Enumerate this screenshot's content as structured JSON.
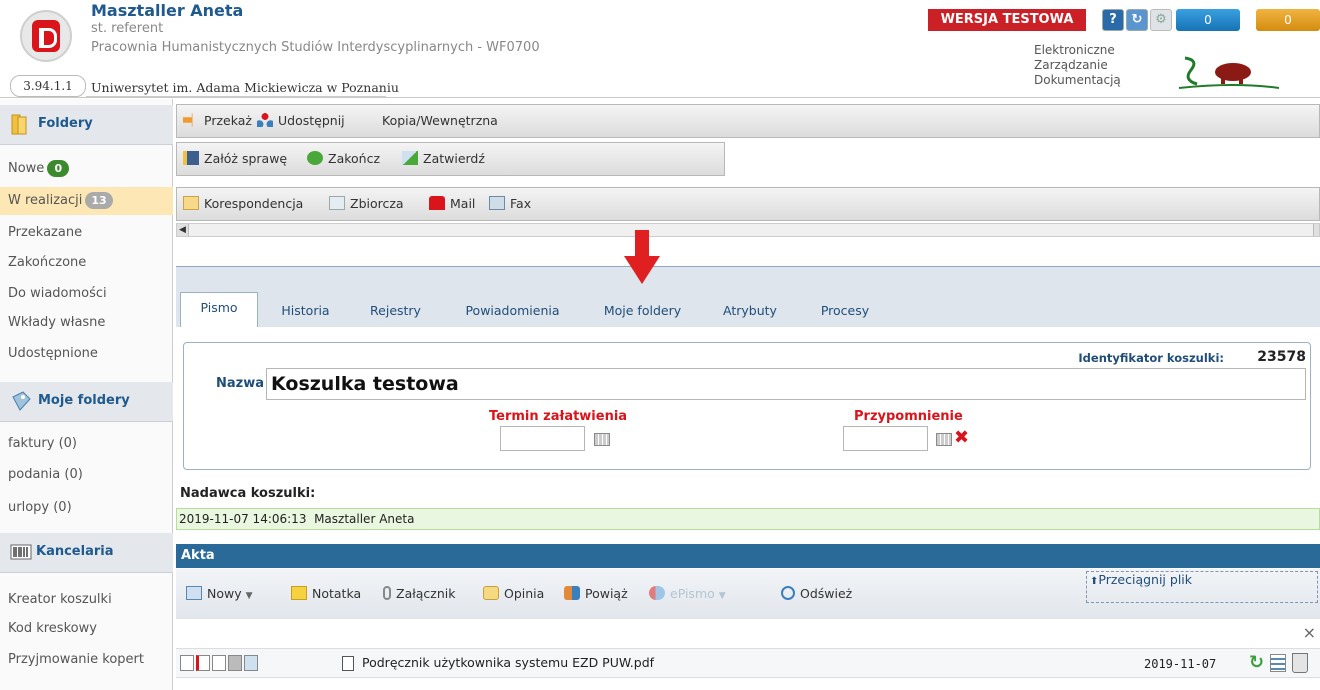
{
  "header": {
    "user_name": "Masztaller Aneta",
    "role": "st. referent",
    "department": "Pracownia Humanistycznych Studiów Interdyscyplinarnych - WF0700",
    "university": "Uniwersytet im. Adama Mickiewicza w Poznaniu",
    "version": "3.94.1.1",
    "test_banner": "WERSJA TESTOWA",
    "help_icon": "?",
    "counter1": "0",
    "counter2": "0",
    "ezd_line1": "Elektroniczne",
    "ezd_line2": "Zarządzanie",
    "ezd_line3": "Dokumentacją"
  },
  "sidebar": {
    "folders_header": "Foldery",
    "folders": [
      {
        "label": "Nowe",
        "badge": "0"
      },
      {
        "label": "W realizacji",
        "badge": "13"
      },
      {
        "label": "Przekazane"
      },
      {
        "label": "Zakończone"
      },
      {
        "label": "Do wiadomości"
      },
      {
        "label": "Wkłady własne"
      },
      {
        "label": "Udostępnione"
      }
    ],
    "my_folders_header": "Moje foldery",
    "my_folders": [
      "faktury (0)",
      "podania (0)",
      "urlopy (0)"
    ],
    "office_header": "Kancelaria",
    "office": [
      "Kreator koszulki",
      "Kod kreskowy",
      "Przyjmowanie kopert"
    ]
  },
  "toolbar1": {
    "forward": "Przekaż",
    "share": "Udostępnij",
    "copy": "Kopia/Wewnętrzna"
  },
  "toolbar2": {
    "create_case": "Załóż sprawę",
    "finish": "Zakończ",
    "approve": "Zatwierdź"
  },
  "toolbar3": {
    "correspondence": "Korespondencja",
    "collective": "Zbiorcza",
    "mail": "Mail",
    "fax": "Fax"
  },
  "tabs": [
    "Pismo",
    "Historia",
    "Rejestry",
    "Powiadomienia",
    "Moje foldery",
    "Atrybuty",
    "Procesy"
  ],
  "form": {
    "id_label": "Identyfikator koszulki:",
    "id_value": "23578",
    "name_label": "Nazwa",
    "name_value": "Koszulka testowa",
    "deadline_label": "Termin załatwienia",
    "reminder_label": "Przypomnienie"
  },
  "sender": {
    "label": "Nadawca koszulki:",
    "value": "2019-11-07 14:06:13  Masztaller Aneta"
  },
  "akta": {
    "title": "Akta",
    "new": "Nowy",
    "note": "Notatka",
    "attachment": "Załącznik",
    "opinion": "Opinia",
    "link": "Powiąż",
    "epismo": "ePismo",
    "refresh": "Odśwież",
    "drag": "Przeciągnij plik"
  },
  "file": {
    "name": "Podręcznik użytkownika systemu EZD PUW.pdf",
    "date": "2019-11-07",
    "close_x": "×"
  },
  "colors": {
    "accent_blue": "#2a6a99",
    "red": "#d9141b",
    "green_badge": "#3c8a2e",
    "orange_badge": "#e39b2b"
  }
}
